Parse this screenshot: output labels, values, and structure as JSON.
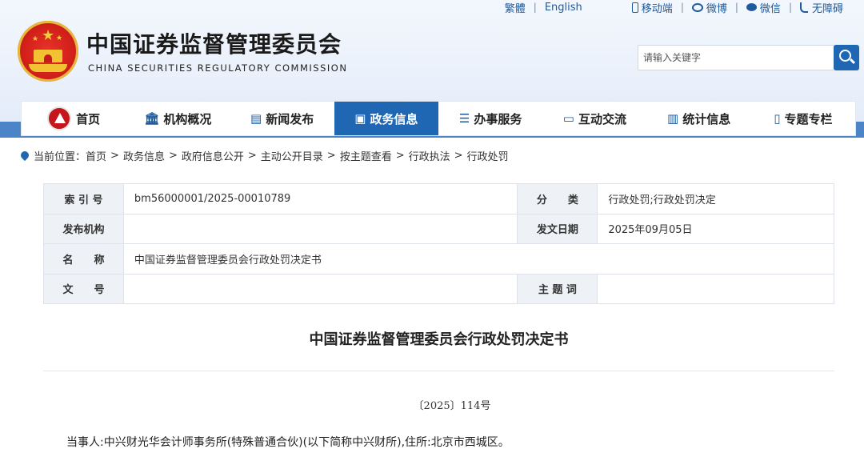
{
  "toplinks": {
    "traditional": "繁體",
    "english": "English",
    "mobile": "移动端",
    "weibo": "微博",
    "wechat": "微信",
    "accessibility": "无障碍"
  },
  "header": {
    "title": "中国证券监督管理委员会",
    "subtitle": "CHINA SECURITIES REGULATORY COMMISSION"
  },
  "search": {
    "placeholder": "请输入关键字"
  },
  "nav": [
    {
      "label": "首页",
      "icon": "csrc-logo"
    },
    {
      "label": "机构概况",
      "icon": "institution-icon"
    },
    {
      "label": "新闻发布",
      "icon": "news-icon"
    },
    {
      "label": "政务信息",
      "icon": "government-info-icon",
      "active": true
    },
    {
      "label": "办事服务",
      "icon": "service-icon"
    },
    {
      "label": "互动交流",
      "icon": "chat-icon"
    },
    {
      "label": "统计信息",
      "icon": "statistics-icon"
    },
    {
      "label": "专题专栏",
      "icon": "topic-icon"
    }
  ],
  "breadcrumb": {
    "prefix": "当前位置：",
    "items": [
      "首页",
      "政务信息",
      "政府信息公开",
      "主动公开目录",
      "按主题查看",
      "行政执法",
      "行政处罚"
    ]
  },
  "info": {
    "index_label": "索 引 号",
    "index_value": "bm56000001/2025-00010789",
    "category_label": "分　　类",
    "category_value": "行政处罚;行政处罚决定",
    "publisher_label": "发布机构",
    "publisher_value": "",
    "date_label": "发文日期",
    "date_value": "2025年09月05日",
    "name_label": "名　　称",
    "name_value": "中国证券监督管理委员会行政处罚决定书",
    "docno_label": "文　　号",
    "docno_value": "",
    "keyword_label": "主 题 词",
    "keyword_value": ""
  },
  "document": {
    "title": "中国证券监督管理委员会行政处罚决定书",
    "number": "〔2025〕114号",
    "party": "当事人:中兴财光华会计师事务所(特殊普通合伙)(以下简称中兴财所),住所:北京市西城区。"
  },
  "colors": {
    "primary": "#1f67b3",
    "strip": "#4c84c8",
    "label_bg": "#eef1f6"
  }
}
